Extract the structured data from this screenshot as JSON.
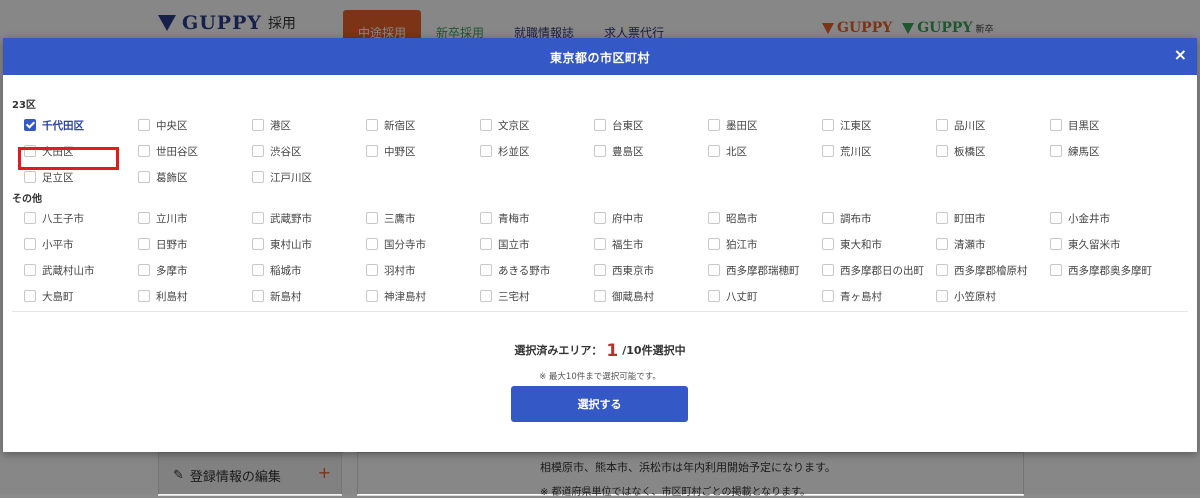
{
  "background": {
    "logo_text": "GUPPY",
    "logo_suffix": "採用",
    "nav_tabs": [
      "中途採用",
      "新卒採用",
      "就職情報誌",
      "求人票代行"
    ],
    "right_logo_1": "GUPPY",
    "right_logo_2": "GUPPY",
    "right_logo_2_suffix": "新卒",
    "sidebar_item_label": "登録情報の編集",
    "sidebar_plus": "+",
    "main_note_1": "相模原市、熊本市、浜松市は年内利用開始予定になります。",
    "main_note_2": "※ 都道府県単位ではなく、市区町村ごとの掲載となります。",
    "colors": {
      "orange": "#e8632a",
      "green": "#3aa35b",
      "navy": "#2c3e8f"
    }
  },
  "modal": {
    "title": "東京都の市区町村",
    "close_label": "×",
    "section_wards_label": "23区",
    "section_other_label": "その他",
    "wards": [
      [
        "千代田区",
        "中央区",
        "港区",
        "新宿区",
        "文京区",
        "台東区",
        "墨田区",
        "江東区",
        "品川区",
        "目黒区"
      ],
      [
        "大田区",
        "世田谷区",
        "渋谷区",
        "中野区",
        "杉並区",
        "豊島区",
        "北区",
        "荒川区",
        "板橋区",
        "練馬区"
      ],
      [
        "足立区",
        "葛飾区",
        "江戸川区"
      ]
    ],
    "others": [
      [
        "八王子市",
        "立川市",
        "武蔵野市",
        "三鷹市",
        "青梅市",
        "府中市",
        "昭島市",
        "調布市",
        "町田市",
        "小金井市"
      ],
      [
        "小平市",
        "日野市",
        "東村山市",
        "国分寺市",
        "国立市",
        "福生市",
        "狛江市",
        "東大和市",
        "清瀬市",
        "東久留米市"
      ],
      [
        "武蔵村山市",
        "多摩市",
        "稲城市",
        "羽村市",
        "あきる野市",
        "西東京市",
        "西多摩郡瑞穂町",
        "西多摩郡日の出町",
        "西多摩郡檜原村",
        "西多摩郡奥多摩町"
      ],
      [
        "大島町",
        "利島村",
        "新島村",
        "神津島村",
        "三宅村",
        "御蔵島村",
        "八丈町",
        "青ヶ島村",
        "小笠原村"
      ]
    ],
    "checked": [
      "千代田区"
    ],
    "summary_label": "選択済みエリア：",
    "summary_count": "1",
    "summary_suffix": "/10件選択中",
    "hint": "※ 最大10件まで選択可能です。",
    "submit_label": "選択する",
    "accent_color": "#3558c7"
  }
}
